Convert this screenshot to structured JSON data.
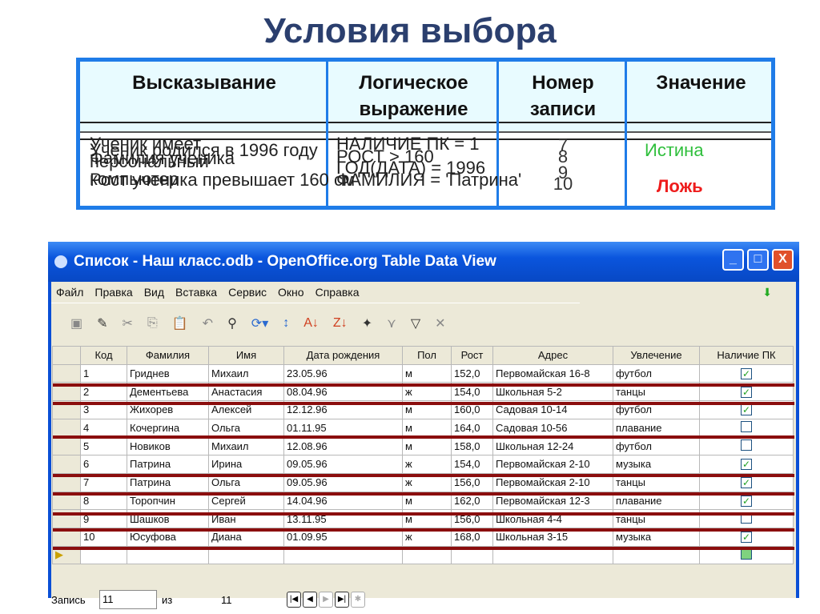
{
  "title": "Условия выбора",
  "conditions": {
    "headers": [
      "Высказывание",
      "Логическое выражение",
      "Номер записи",
      "Значение"
    ],
    "statements": [
      "Ученик имеет персональный компьютер",
      "Ученик родился в 1996 году",
      "Рост ученика превышает 160 см",
      "Фамилия ученика"
    ],
    "expressions": [
      "НАЛИЧИЕ ПК = 1",
      "РОСТ > 160",
      "ГОД(ДАТА) = 1996",
      "ФАМИЛИЯ = 'Патрина'"
    ],
    "record_numbers": [
      "7",
      "8",
      "9",
      "10"
    ],
    "value_true": "Истина",
    "value_false": "Ложь"
  },
  "window": {
    "title": "Список - Наш класс.odb - OpenOffice.org Table Data View",
    "menu": [
      "Файл",
      "Правка",
      "Вид",
      "Вставка",
      "Сервис",
      "Окно",
      "Справка"
    ],
    "columns": [
      "Код",
      "Фамилия",
      "Имя",
      "Дата рождения",
      "Пол",
      "Рост",
      "Адрес",
      "Увлечение",
      "Наличие ПК"
    ],
    "rows": [
      [
        "1",
        "Гриднев",
        "Михаил",
        "23.05.96",
        "м",
        "152,0",
        "Первомайская 16-8",
        "футбол",
        true
      ],
      [
        "2",
        "Дементьева",
        "Анастасия",
        "08.04.96",
        "ж",
        "154,0",
        "Школьная 5-2",
        "танцы",
        true
      ],
      [
        "3",
        "Жихорев",
        "Алексей",
        "12.12.96",
        "м",
        "160,0",
        "Садовая 10-14",
        "футбол",
        true
      ],
      [
        "4",
        "Кочергина",
        "Ольга",
        "01.11.95",
        "м",
        "164,0",
        "Садовая 10-56",
        "плавание",
        false
      ],
      [
        "5",
        "Новиков",
        "Михаил",
        "12.08.96",
        "м",
        "158,0",
        "Школьная 12-24",
        "футбол",
        false
      ],
      [
        "6",
        "Патрина",
        "Ирина",
        "09.05.96",
        "ж",
        "154,0",
        "Первомайская 2-10",
        "музыка",
        true
      ],
      [
        "7",
        "Патрина",
        "Ольга",
        "09.05.96",
        "ж",
        "156,0",
        "Первомайская 2-10",
        "танцы",
        true
      ],
      [
        "8",
        "Торопчин",
        "Сергей",
        "14.04.96",
        "м",
        "162,0",
        "Первомайская 12-3",
        "плавание",
        true
      ],
      [
        "9",
        "Шашков",
        "Иван",
        "13.11.95",
        "м",
        "156,0",
        "Школьная 4-4",
        "танцы",
        false
      ],
      [
        "10",
        "Юсуфова",
        "Диана",
        "01.09.95",
        "ж",
        "168,0",
        "Школьная 3-15",
        "музыка",
        true
      ]
    ],
    "nav": {
      "record_label": "Запись",
      "record_value": "11",
      "of_label": "из",
      "total": "11"
    }
  }
}
